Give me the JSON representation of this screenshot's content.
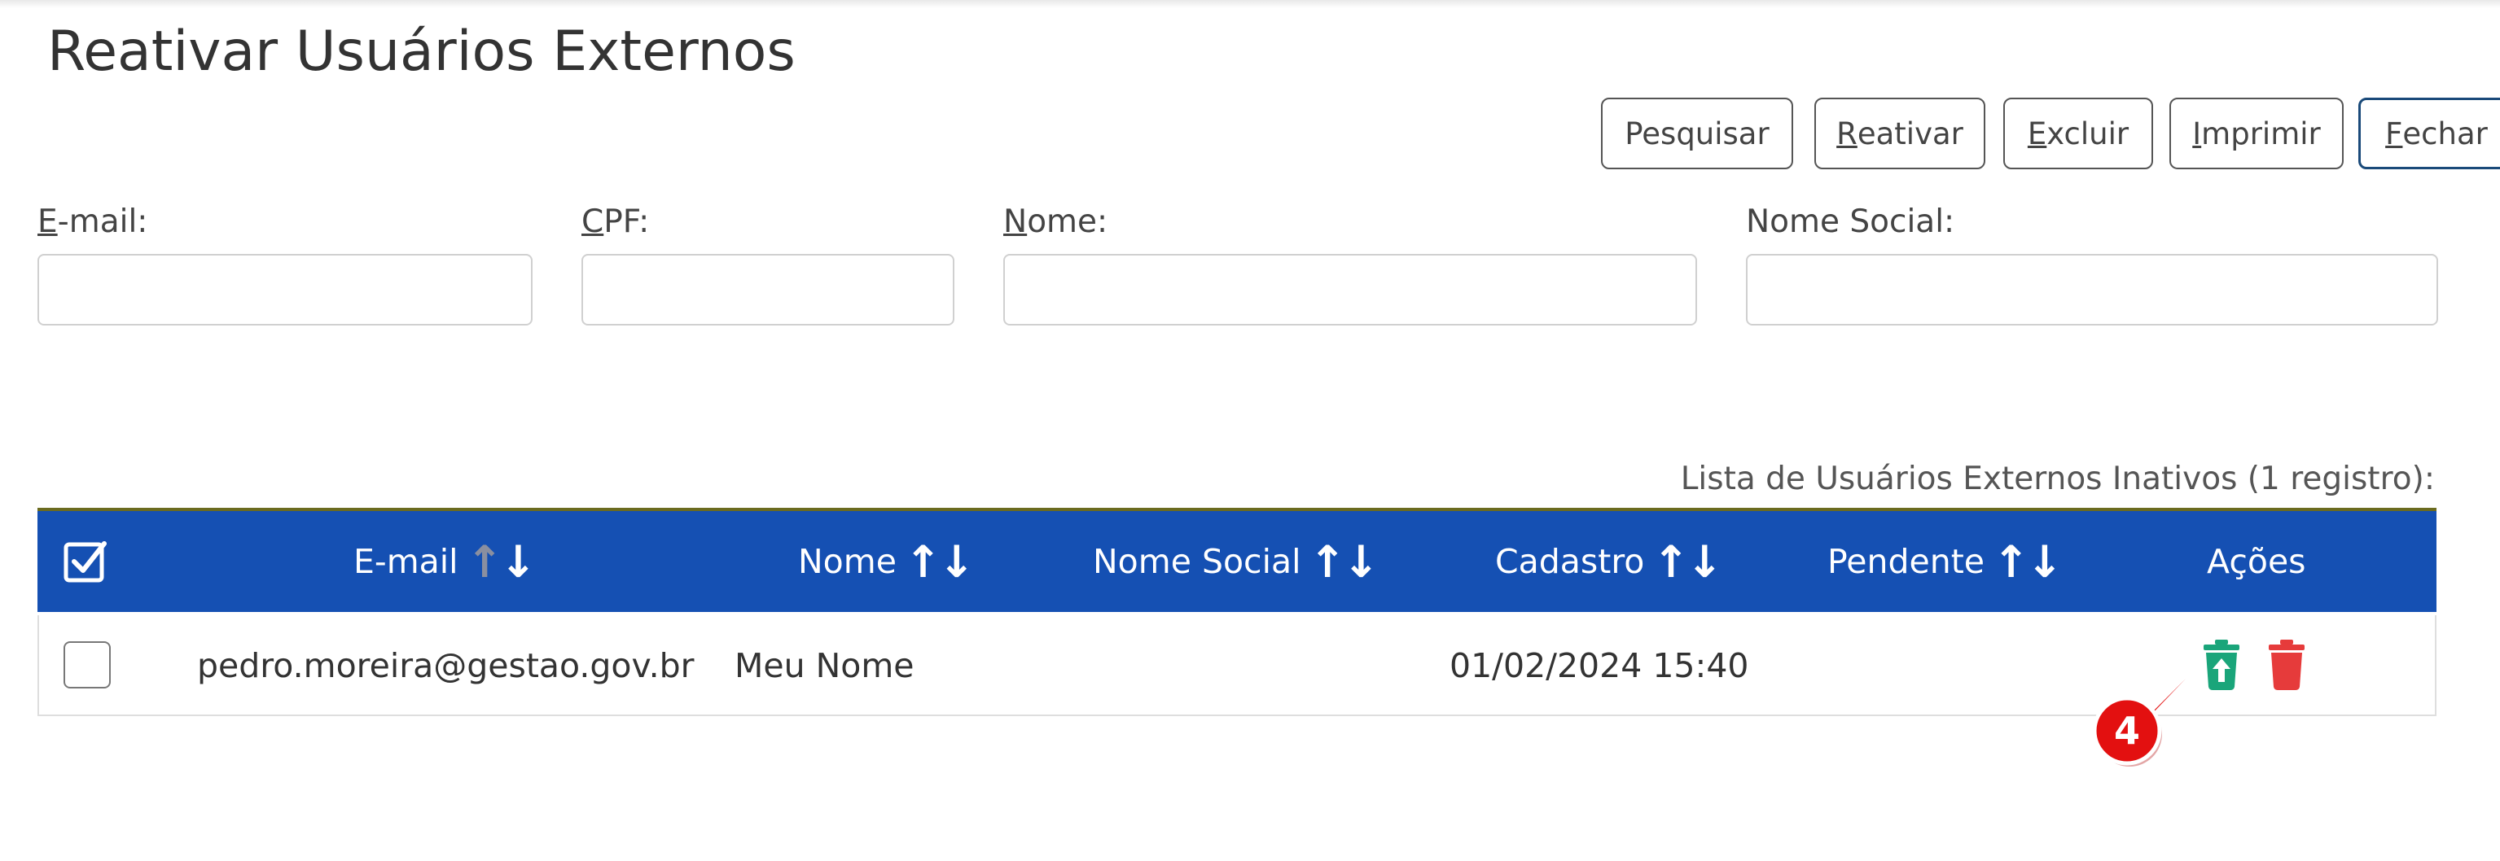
{
  "page": {
    "title": "Reativar Usuários Externos"
  },
  "toolbar": {
    "pesquisar": "Pesquisar",
    "reativar_key": "R",
    "reativar_rest": "eativar",
    "excluir_key": "E",
    "excluir_rest": "xcluir",
    "imprimir_key": "I",
    "imprimir_rest": "mprimir",
    "fechar_key": "F",
    "fechar_rest": "echar"
  },
  "filters": {
    "email_key": "E",
    "email_rest": "-mail:",
    "email_value": "",
    "cpf_key": "C",
    "cpf_rest": "PF:",
    "cpf_value": "",
    "nome_key": "N",
    "nome_rest": "ome:",
    "nome_value": "",
    "nome_social_label": "Nome Social:",
    "nome_social_value": ""
  },
  "table": {
    "caption": "Lista de Usuários Externos Inativos (1 registro):",
    "columns": [
      "E-mail",
      "Nome",
      "Nome Social",
      "Cadastro",
      "Pendente",
      "Ações"
    ],
    "rows": [
      {
        "checked": false,
        "email": "pedro.moreira@gestao.gov.br",
        "nome": "Meu Nome",
        "nome_social": "",
        "cadastro": "01/02/2024 15:40",
        "pendente": "",
        "actions": [
          "reactivate-icon",
          "trash-icon"
        ]
      }
    ]
  },
  "callout": {
    "number": "4"
  },
  "colors": {
    "header_bg": "#1550b3",
    "reactivate": "#1aa57a",
    "delete": "#e63b3b",
    "callout": "#e31010"
  }
}
